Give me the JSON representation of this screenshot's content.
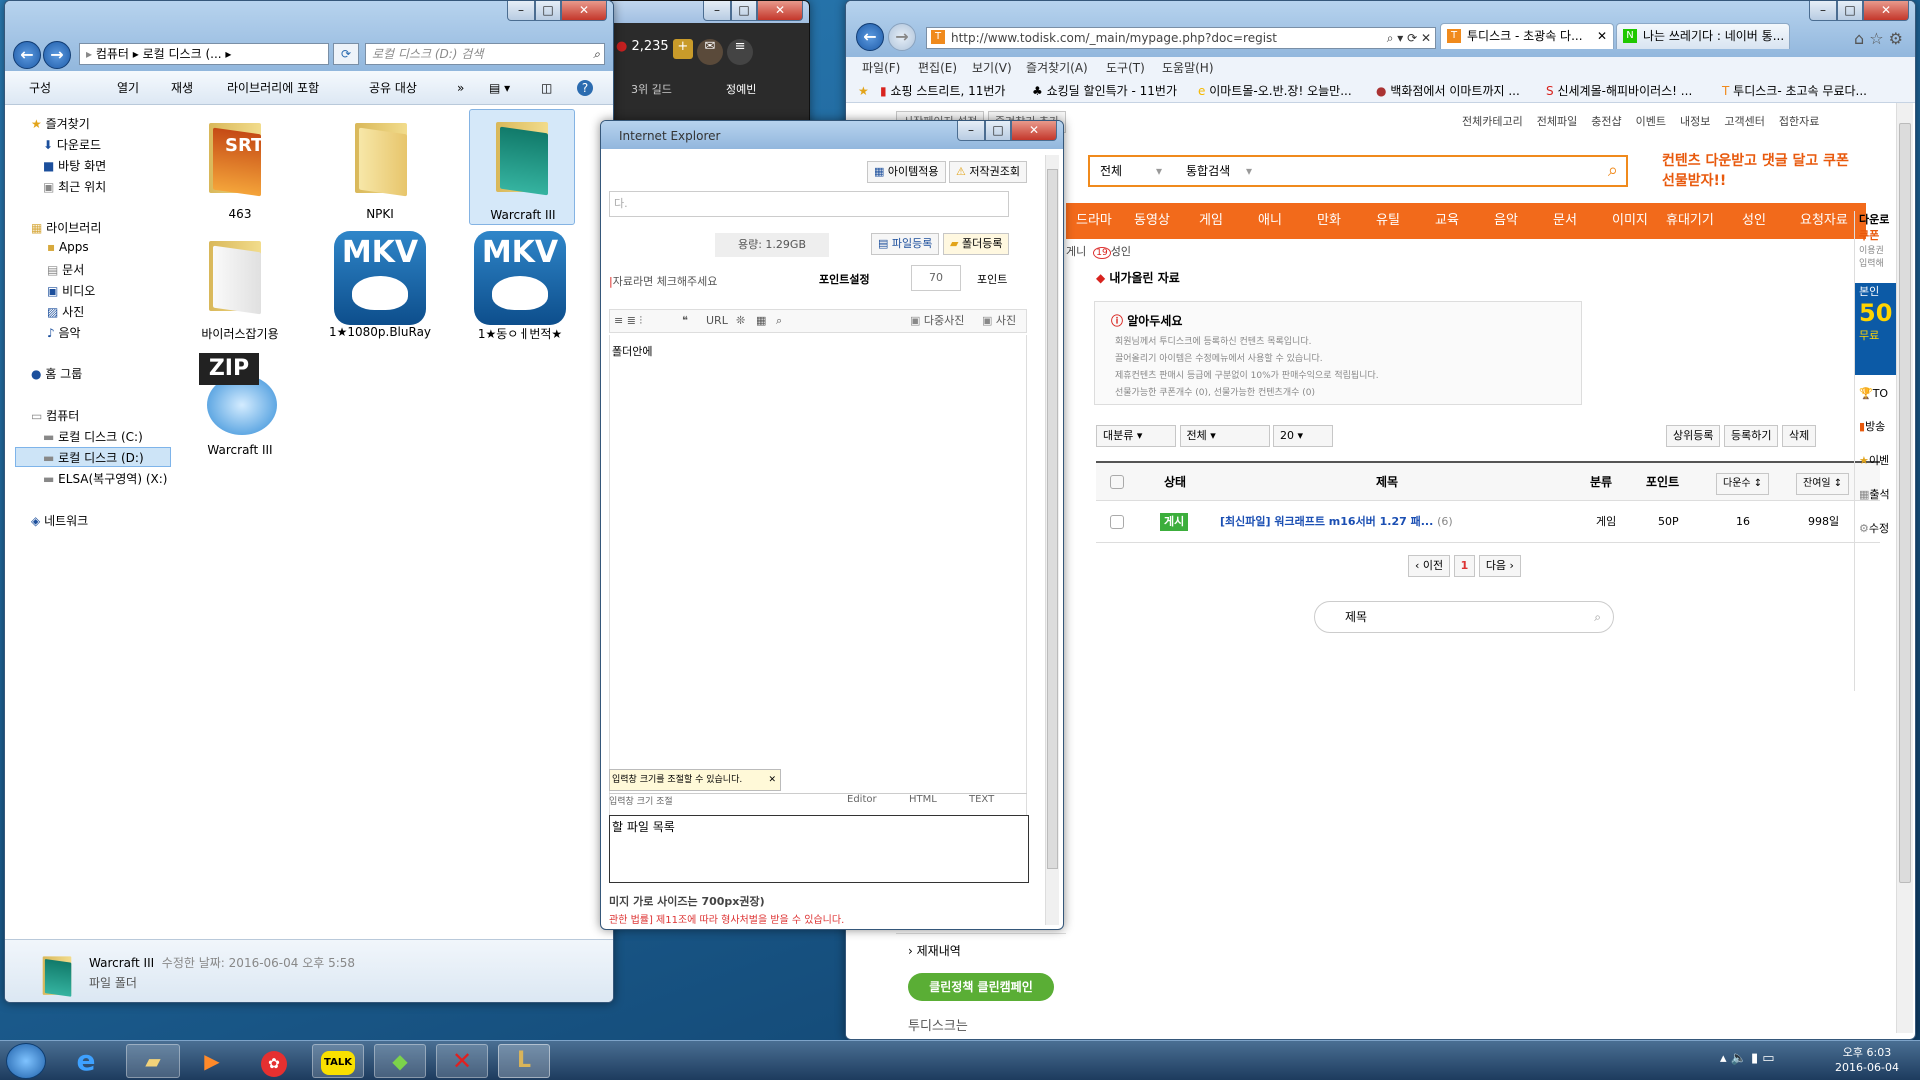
{
  "explorer": {
    "path": [
      "컴퓨터",
      "로컬 디스크 (...",
      ""
    ],
    "search_placeholder": "로컬 디스크 (D:) 검색",
    "toolbar": [
      "구성",
      "열기",
      "재생",
      "라이브러리에 포함",
      "공유 대상",
      "»"
    ],
    "nav": {
      "favorites": "즐겨찾기",
      "downloads": "다운로드",
      "desktop": "바탕 화면",
      "recent": "최근 위치",
      "libraries": "라이브러리",
      "apps": "Apps",
      "docs": "문서",
      "video": "비디오",
      "photos": "사진",
      "music": "음악",
      "homegroup": "홈 그룹",
      "computer": "컴퓨터",
      "driveC": "로컬 디스크 (C:)",
      "driveD": "로컬 디스크 (D:)",
      "driveX": "ELSA(복구영역) (X:)",
      "network": "네트워크"
    },
    "files": {
      "f1": "463",
      "f2": "NPKI",
      "f3": "Warcraft III",
      "f4": "바이러스잡기용",
      "f5": "1★1080p.BluRay",
      "f6": "1★동ㅇㅔ번적★",
      "f7": "Warcraft III",
      "srt": "SRT",
      "mkv": "MKV",
      "zip": "ZIP"
    },
    "status": {
      "name": "Warcraft III",
      "modified": "수정한 날짜: 2016-06-04 오후 5:58",
      "type": "파일 폴더"
    }
  },
  "game": {
    "gold": "2,235",
    "label1": "3위 길드",
    "label2": "정예빈"
  },
  "ie_popup": {
    "title": "Internet Explorer",
    "item_apply": "아이템적용",
    "copyright": "저작권조회",
    "placeholder": "다.",
    "size": "용량: 1.29GB",
    "file_reg": "파일등록",
    "folder_reg": "폴더등록",
    "check_note": "자료라면 체크해주세요",
    "point_label": "포인트설정",
    "point_val": "70",
    "point_unit": "포인트",
    "multi_photo": "다중사진",
    "photo": "사진",
    "body_text": "폴더안에",
    "resize_note": "입력창 크기를 조절할 수 있습니다.",
    "resize_label": "입력창 크기 조절",
    "mode": [
      "Editor",
      "HTML",
      "TEXT"
    ],
    "upload_list": "할 파일 목록",
    "width_note": "미지 가로 사이즈는 700px권장)",
    "law_note": "관한 법률] 제11조에 따라 형사처벌을 받을 수 있습니다."
  },
  "browser": {
    "url": "http://www.todisk.com/_main/mypage.php?doc=regist",
    "tab1": "투디스크 - 초광속 다...",
    "tab2": "나는 쓰레기다 : 네이버 통...",
    "menu": [
      "파일(F)",
      "편집(E)",
      "보기(V)",
      "즐겨찾기(A)",
      "도구(T)",
      "도움말(H)"
    ],
    "favs": [
      "쇼핑 스트리트, 11번가",
      "쇼킹딜 할인특가 - 11번가",
      "이마트몰-오.반.장! 오늘만...",
      "백화점에서 이마트까지 ...",
      "신세계몰-해피바이러스! ...",
      "투디스크- 초고속 무료다..."
    ]
  },
  "todisk": {
    "top_btns": [
      "시작페이지 설정",
      "즐겨찾기 추가"
    ],
    "top_links": [
      "전체카테고리",
      "전체파일",
      "충전샵",
      "이벤트",
      "내정보",
      "고객센터",
      "접한자료"
    ],
    "search_cat": "전체",
    "search_type": "통합검색",
    "banner": "컨텐츠 다운받고 댓글 달고 쿠폰선물받자!!",
    "nav": [
      "드라마",
      "동영상",
      "게임",
      "애니",
      "만화",
      "유틸",
      "교육",
      "음악",
      "문서",
      "이미지",
      "휴대기기",
      "성인",
      "요청자료"
    ],
    "sub": [
      "게니",
      "성인"
    ],
    "section_title": "내가올린 자료",
    "notice_title": "알아두세요",
    "notice_lines": [
      "회원님께서 투디스크에 등록하신 컨텐츠 목록입니다.",
      "끌어올리기 아이템은 수정메뉴에서 사용할 수 있습니다.",
      "제휴컨텐츠 판매시 등급에 구분없이 10%가 판매수익으로 적립됩니다.",
      "선물가능한 쿠폰개수 (0), 선물가능한 컨텐츠개수 (0)"
    ],
    "filters": [
      "대분류",
      "전체",
      "20"
    ],
    "actions": [
      "상위등록",
      "등록하기",
      "삭제"
    ],
    "headers": [
      "상태",
      "제목",
      "분류",
      "포인트",
      "다운수",
      "잔여일"
    ],
    "row": {
      "status": "게시",
      "title": "[최신파일] 워크래프트 m16서버 1.27 패...",
      "count": "(6)",
      "cat": "게임",
      "point": "50P",
      "downloads": "16",
      "days": "998일"
    },
    "pager": [
      "이전",
      "1",
      "다음"
    ],
    "search_placeholder": "제목",
    "side": [
      "제재내역"
    ],
    "clean": "클린정책 클린캠페인",
    "todisk_is": "투디스크는",
    "right_side": [
      "다운로",
      "쿠폰",
      "이용권",
      "입력해",
      "본인",
      "50",
      "무료",
      "TO",
      "방송",
      "이벤",
      "출석",
      "수정"
    ]
  },
  "taskbar": {
    "time": "오후 6:03",
    "date": "2016-06-04"
  }
}
